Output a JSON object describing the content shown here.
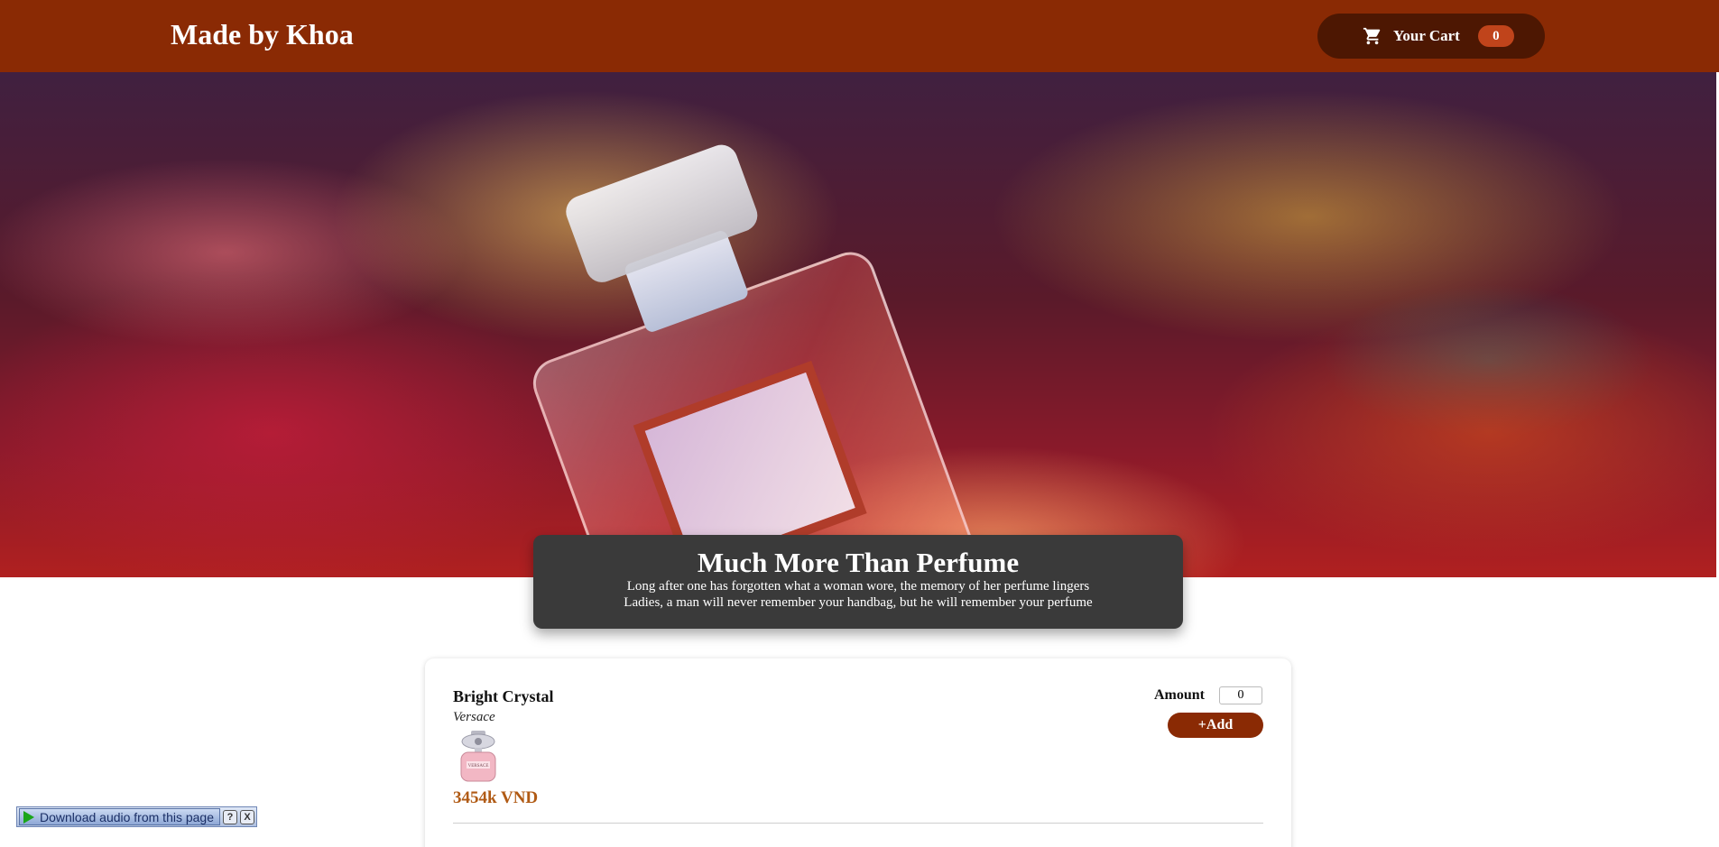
{
  "header": {
    "brand": "Made by Khoa",
    "cart_label": "Your Cart",
    "cart_count": "0"
  },
  "hero": {
    "title": "Much More Than Perfume",
    "line1": "Long after one has forgotten what a woman wore, the memory of her perfume lingers",
    "line2": "Ladies, a man will never remember your handbag, but he will remember your perfume"
  },
  "product": {
    "name": "Bright Crystal",
    "brand": "Versace",
    "price": "3454k VND",
    "amount_label": "Amount",
    "amount_value": "0",
    "add_label": "+Add",
    "image_label": "VERSACE"
  },
  "audio_toolbar": {
    "label": "Download audio from this page",
    "help": "?",
    "close": "X"
  },
  "icons": {
    "cart": "cart-icon",
    "play": "play-icon"
  },
  "colors": {
    "header_bg": "#8a2a04",
    "cart_bg": "#4d1702",
    "badge_bg": "#c0441b",
    "price": "#b05a14",
    "caption_bg": "#3a3a3a"
  }
}
